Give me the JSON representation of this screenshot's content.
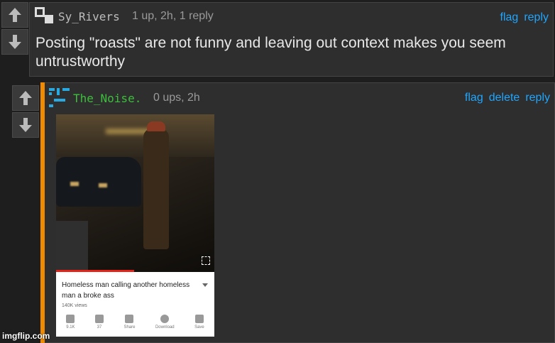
{
  "comments": [
    {
      "username": "Sy_Rivers",
      "meta": "1 up, 2h, 1 reply",
      "actions": [
        "flag",
        "reply"
      ],
      "text": "Posting \"roasts\" are not funny and leaving out context makes you seem untrustworthy"
    },
    {
      "username": "The_Noise.",
      "meta": "0 ups, 2h",
      "actions": [
        "flag",
        "delete",
        "reply"
      ],
      "image": {
        "title": "Homeless man calling another homeless man a broke ass",
        "views": "140K views",
        "buttons": [
          "9.1K",
          "37",
          "Share",
          "Download",
          "Save"
        ]
      }
    }
  ],
  "watermark": "imgflip.com",
  "colors": {
    "accent": "#1fa6ff",
    "reply_border": "#f08a00",
    "username_green": "#3cbf3c"
  }
}
